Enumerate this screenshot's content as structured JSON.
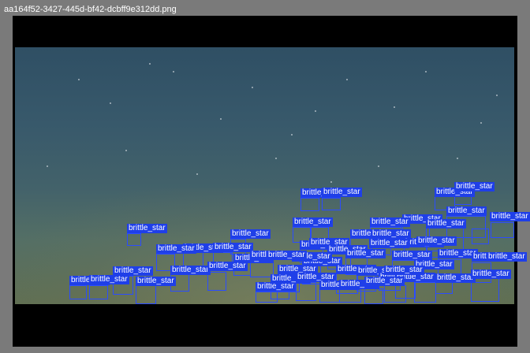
{
  "window": {
    "filename": "aa164f52-3427-445d-bf42-dcbff9e312dd.png"
  },
  "colors": {
    "frame": "#7a7a7a",
    "viewer_background": "#000000",
    "box_outline": "#2b4cff",
    "label_background": "#1f3fe8",
    "label_text": "#ffffff"
  },
  "annotation": {
    "class_label": "brittle_star"
  }
}
